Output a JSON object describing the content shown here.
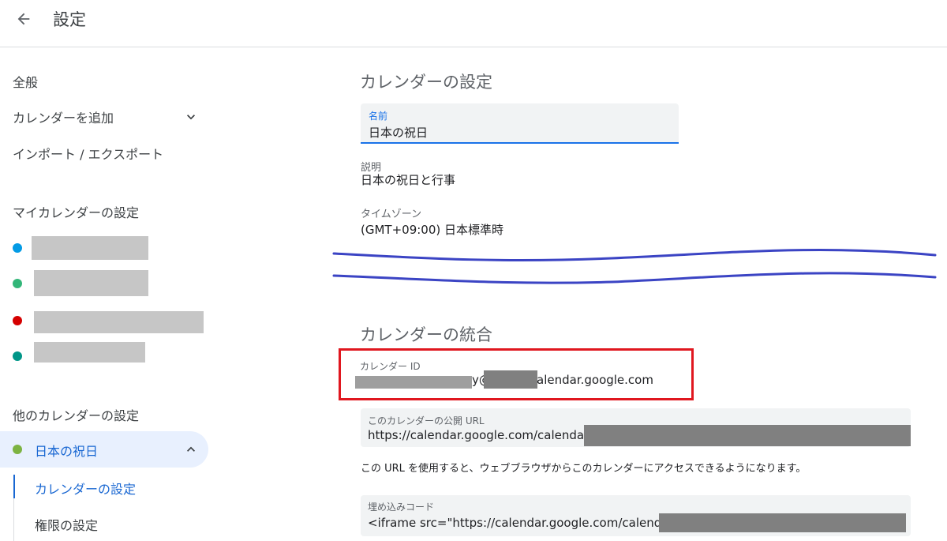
{
  "header": {
    "title": "設定",
    "back_icon": "arrow-back-icon"
  },
  "sidebar": {
    "items": [
      {
        "label": "全般"
      },
      {
        "label": "カレンダーを追加"
      },
      {
        "label": "インポート / エクスポート"
      }
    ],
    "my_calendars_heading": "マイカレンダーの設定",
    "my_calendars": [
      {
        "color": "#039be5"
      },
      {
        "color": "#33b679"
      },
      {
        "color": "#d50000"
      },
      {
        "color": "#009688"
      }
    ],
    "other_calendars_heading": "他のカレンダーの設定",
    "selected_calendar": {
      "label": "日本の祝日",
      "color": "#7cb342"
    },
    "sub_items": [
      {
        "label": "カレンダーの設定"
      },
      {
        "label": "権限の設定"
      }
    ]
  },
  "main": {
    "calendar_settings": {
      "heading": "カレンダーの設定",
      "name_label": "名前",
      "name_value": "日本の祝日",
      "description_label": "説明",
      "description_value": "日本の祝日と行事",
      "timezone_label": "タイムゾーン",
      "timezone_value": "(GMT+09:00) 日本標準時"
    },
    "integration": {
      "heading": "カレンダーの統合",
      "calendar_id_label": "カレンダー ID",
      "calendar_id_at": "y@",
      "calendar_id_suffix": "alendar.google.com",
      "public_url_label": "このカレンダーの公開 URL",
      "public_url_value": "https://calendar.google.com/calendar/",
      "help_text": "この URL を使用すると、ウェブブラウザからこのカレンダーにアクセスできるようになります。",
      "embed_label": "埋め込みコード",
      "embed_value": "<iframe src=\"https://calendar.google.com/calendar/"
    },
    "annotation_colors": {
      "highlight": "#e0171f",
      "wave": "#3b44c4"
    }
  }
}
